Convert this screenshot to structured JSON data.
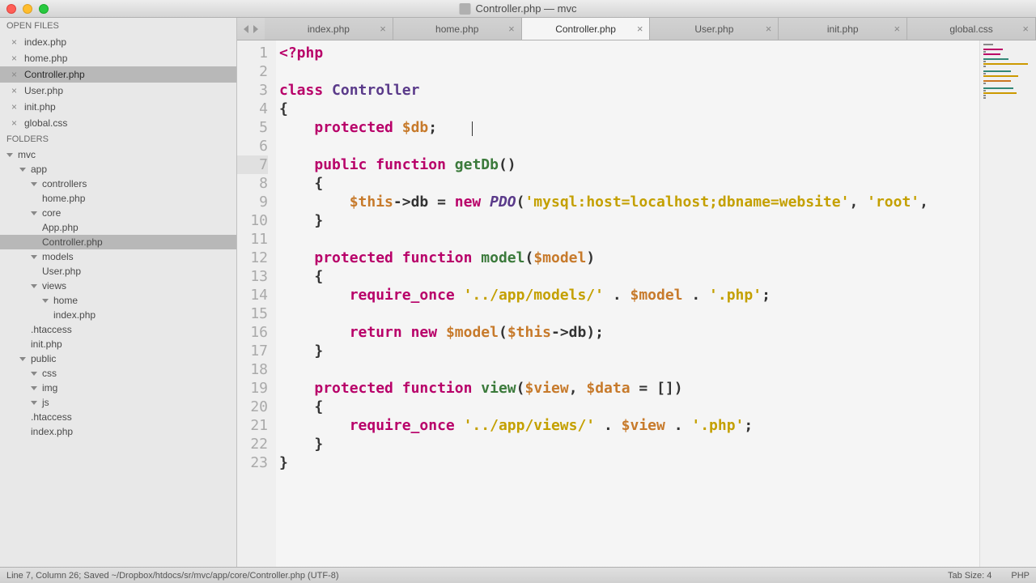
{
  "window": {
    "title": "Controller.php — mvc"
  },
  "sidebar": {
    "open_files_header": "OPEN FILES",
    "open_files": [
      {
        "name": "index.php",
        "active": false
      },
      {
        "name": "home.php",
        "active": false
      },
      {
        "name": "Controller.php",
        "active": true
      },
      {
        "name": "User.php",
        "active": false
      },
      {
        "name": "init.php",
        "active": false
      },
      {
        "name": "global.css",
        "active": false
      }
    ],
    "folders_header": "FOLDERS",
    "tree": [
      {
        "label": "mvc",
        "indent": 0,
        "folder": true
      },
      {
        "label": "app",
        "indent": 1,
        "folder": true
      },
      {
        "label": "controllers",
        "indent": 2,
        "folder": true
      },
      {
        "label": "home.php",
        "indent": 3,
        "folder": false
      },
      {
        "label": "core",
        "indent": 2,
        "folder": true
      },
      {
        "label": "App.php",
        "indent": 3,
        "folder": false
      },
      {
        "label": "Controller.php",
        "indent": 3,
        "folder": false,
        "active": true
      },
      {
        "label": "models",
        "indent": 2,
        "folder": true
      },
      {
        "label": "User.php",
        "indent": 3,
        "folder": false
      },
      {
        "label": "views",
        "indent": 2,
        "folder": true
      },
      {
        "label": "home",
        "indent": 3,
        "folder": true
      },
      {
        "label": "index.php",
        "indent": 4,
        "folder": false
      },
      {
        "label": ".htaccess",
        "indent": 2,
        "folder": false
      },
      {
        "label": "init.php",
        "indent": 2,
        "folder": false
      },
      {
        "label": "public",
        "indent": 1,
        "folder": true
      },
      {
        "label": "css",
        "indent": 2,
        "folder": true
      },
      {
        "label": "img",
        "indent": 2,
        "folder": true
      },
      {
        "label": "js",
        "indent": 2,
        "folder": true
      },
      {
        "label": ".htaccess",
        "indent": 2,
        "folder": false
      },
      {
        "label": "index.php",
        "indent": 2,
        "folder": false
      }
    ]
  },
  "tabs": [
    {
      "label": "index.php",
      "active": false
    },
    {
      "label": "home.php",
      "active": false
    },
    {
      "label": "Controller.php",
      "active": true
    },
    {
      "label": "User.php",
      "active": false
    },
    {
      "label": "init.php",
      "active": false
    },
    {
      "label": "global.css",
      "active": false
    }
  ],
  "code": {
    "line_count": 23,
    "active_line": 7,
    "tokens": {
      "l1_open": "<?php",
      "l3_class": "class",
      "l3_name": "Controller",
      "l4": "{",
      "l5_prot": "protected",
      "l5_var": "$db",
      "l5_semi": ";",
      "l7_pub": "public",
      "l7_func": "function",
      "l7_name": "getDb",
      "l7_par": "()",
      "l8": "{",
      "l9_this": "$this",
      "l9_arrow": "->db = ",
      "l9_new": "new",
      "l9_pdo": "PDO",
      "l9_open": "(",
      "l9_str1": "'mysql:host=localhost;dbname=website'",
      "l9_c1": ", ",
      "l9_str2": "'root'",
      "l9_c2": ",",
      "l10": "}",
      "l12_prot": "protected",
      "l12_func": "function",
      "l12_name": "model",
      "l12_open": "(",
      "l12_var": "$model",
      "l12_close": ")",
      "l13": "{",
      "l14_req": "require_once",
      "l14_s1": "'../app/models/'",
      "l14_dot1": " . ",
      "l14_var": "$model",
      "l14_dot2": " . ",
      "l14_s2": "'.php'",
      "l14_semi": ";",
      "l16_ret": "return",
      "l16_new": "new",
      "l16_var": "$model",
      "l16_open": "(",
      "l16_this": "$this",
      "l16_arrow": "->db);",
      "l17": "}",
      "l19_prot": "protected",
      "l19_func": "function",
      "l19_name": "view",
      "l19_open": "(",
      "l19_v1": "$view",
      "l19_c": ", ",
      "l19_v2": "$data",
      "l19_def": " = [])",
      "l20": "{",
      "l21_req": "require_once",
      "l21_s1": "'../app/views/'",
      "l21_dot1": " . ",
      "l21_var": "$view",
      "l21_dot2": " . ",
      "l21_s2": "'.php'",
      "l21_semi": ";",
      "l22": "}",
      "l23": "}"
    }
  },
  "statusbar": {
    "left": "Line 7, Column 26; Saved ~/Dropbox/htdocs/sr/mvc/app/core/Controller.php (UTF-8)",
    "tab_size": "Tab Size: 4",
    "lang": "PHP"
  }
}
